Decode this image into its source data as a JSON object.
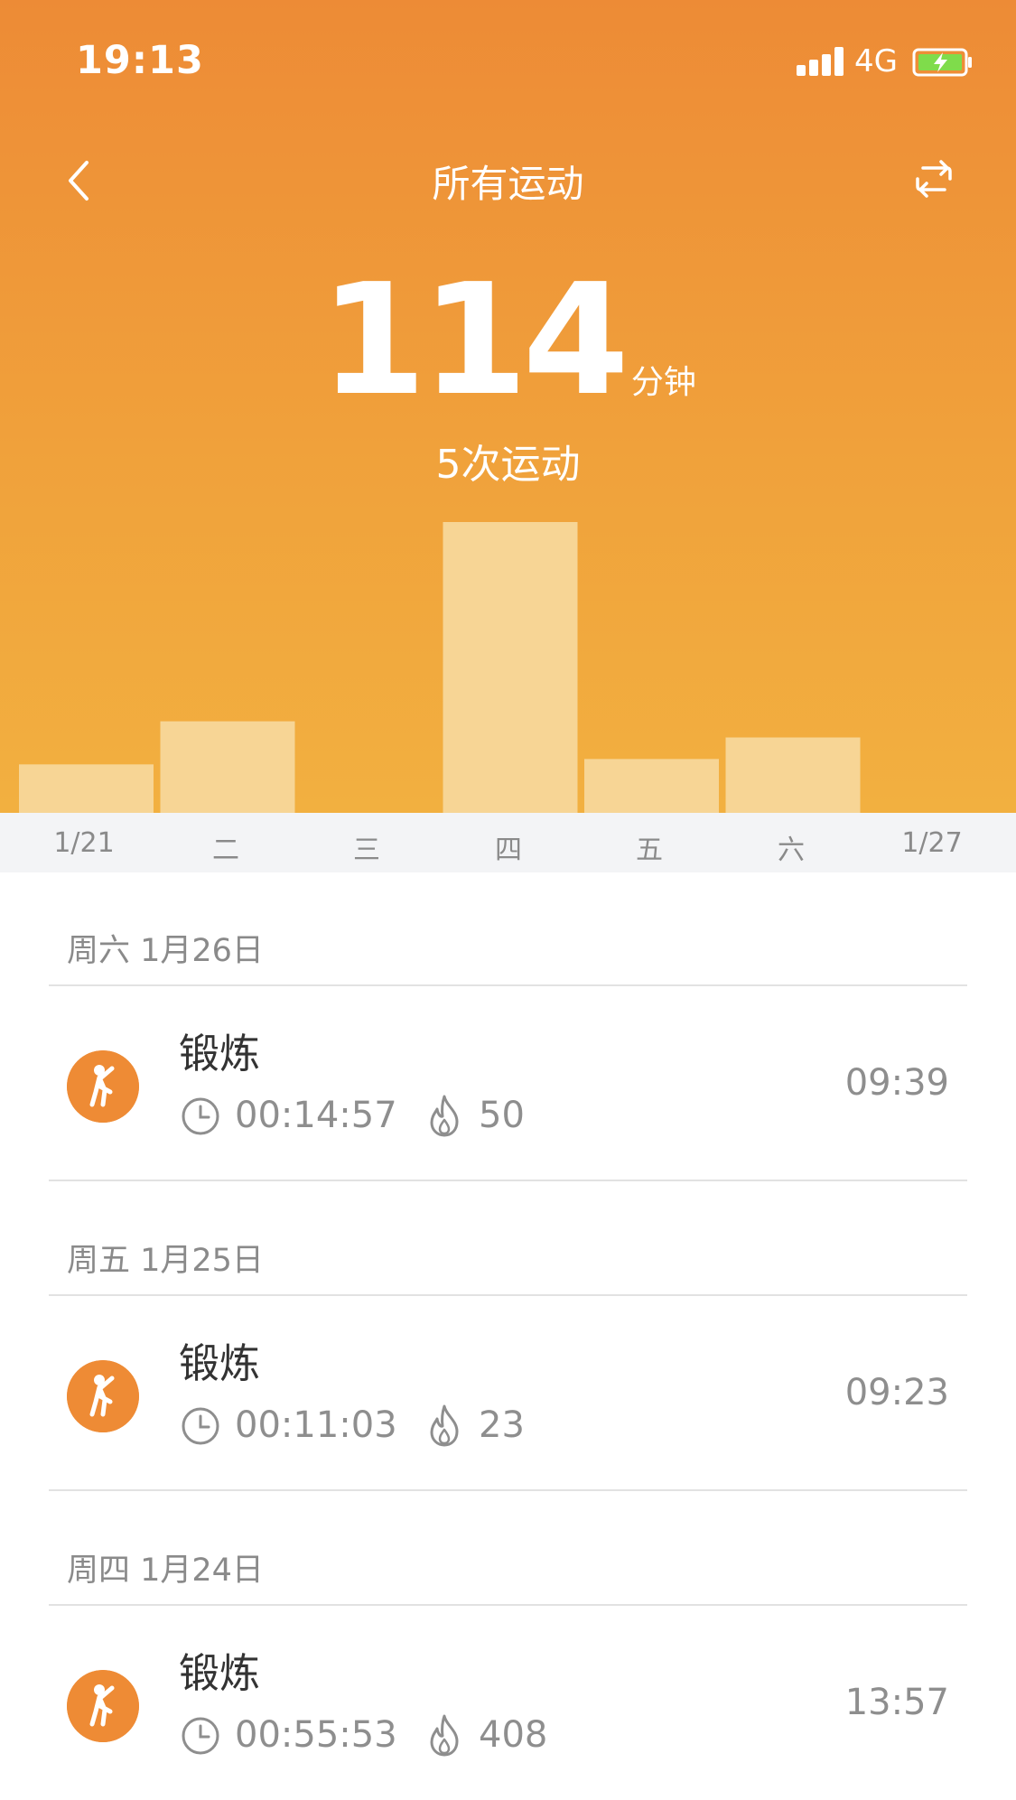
{
  "status_bar": {
    "time": "19:13",
    "network": "4G"
  },
  "header": {
    "title": "所有运动",
    "total_value": "114",
    "total_unit": "分钟",
    "session_count": "5次运动"
  },
  "chart_data": {
    "type": "bar",
    "categories": [
      "1/21",
      "二",
      "三",
      "四",
      "五",
      "六",
      "1/27"
    ],
    "values": [
      9,
      17,
      0,
      54,
      10,
      14,
      0
    ],
    "value_unit": "分钟",
    "bar_color": "#f7d595",
    "background_colors": [
      "#ed8b36",
      "#f2b040"
    ]
  },
  "sections": [
    {
      "date": "周六 1月26日",
      "title": "锻炼",
      "duration": "00:14:57",
      "calories": "50",
      "time": "09:39"
    },
    {
      "date": "周五 1月25日",
      "title": "锻炼",
      "duration": "00:11:03",
      "calories": "23",
      "time": "09:23"
    },
    {
      "date": "周四 1月24日",
      "title": "锻炼",
      "duration": "00:55:53",
      "calories": "408",
      "time": "13:57"
    }
  ],
  "colors": {
    "accent": "#ee8b35",
    "text_secondary": "#8e8e8e"
  },
  "icons": {
    "back": "chevron-left-icon",
    "switch": "swap-icon",
    "exercise": "exercise-person-icon",
    "clock": "clock-icon",
    "flame": "flame-icon"
  }
}
